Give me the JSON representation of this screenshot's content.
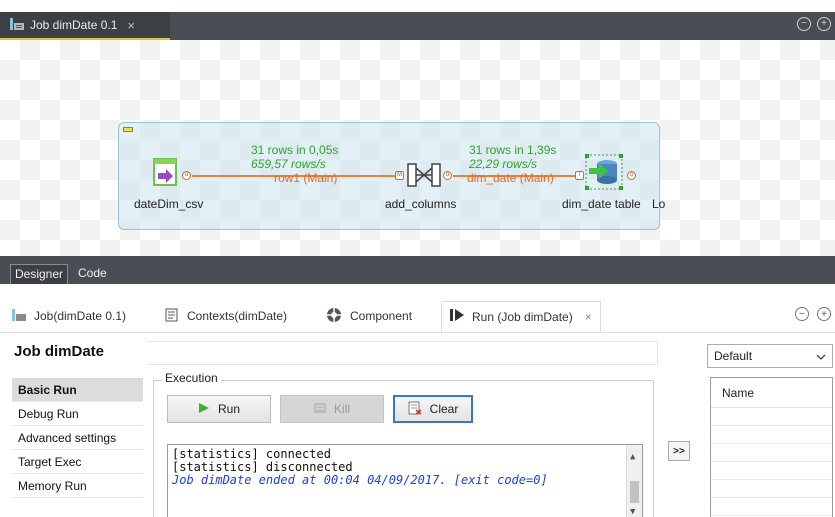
{
  "editor": {
    "tab_label": "Job dimDate 0.1",
    "close": "×",
    "minimize": "−",
    "maximize": "+"
  },
  "canvas": {
    "components": [
      {
        "name": "dateDim_csv"
      },
      {
        "name": "add_columns"
      },
      {
        "name": "dim_date table"
      }
    ],
    "truncated_suffix": "Lo",
    "flows": [
      {
        "rows": "31 rows in 0,05s",
        "rate": "659,57 rows/s",
        "label": "row1 (Main)"
      },
      {
        "rows": "31 rows in 1,39s",
        "rate": "22,29 rows/s",
        "label": "dim_date (Main)"
      }
    ],
    "ports": {
      "out": "o",
      "in_m": "M",
      "in_i": "I"
    }
  },
  "view_tabs": {
    "designer": "Designer",
    "code": "Code"
  },
  "panel_tabs": [
    {
      "label": "Job(dimDate 0.1)"
    },
    {
      "label": "Contexts(dimDate)"
    },
    {
      "label": "Component"
    },
    {
      "label": "Run (Job dimDate)"
    }
  ],
  "run_panel": {
    "title": "Job dimDate",
    "nav": [
      "Basic Run",
      "Debug Run",
      "Advanced settings",
      "Target Exec",
      "Memory Run"
    ],
    "execution_label": "Execution",
    "run_label": "Run",
    "kill_label": "Kill",
    "clear_label": "Clear",
    "console": [
      "[statistics] connected",
      "[statistics] disconnected"
    ],
    "console_end": "Job dimDate ended at 00:04 04/09/2017. [exit code=0]",
    "move_label": ">>"
  },
  "context": {
    "selected": "Default",
    "column_name": "Name"
  },
  "colors": {
    "accent_tab_underline": "#d8c34a",
    "flow_line": "#e7823a",
    "stat_green": "#2fa32f",
    "console_blue": "#1e3fd8"
  }
}
